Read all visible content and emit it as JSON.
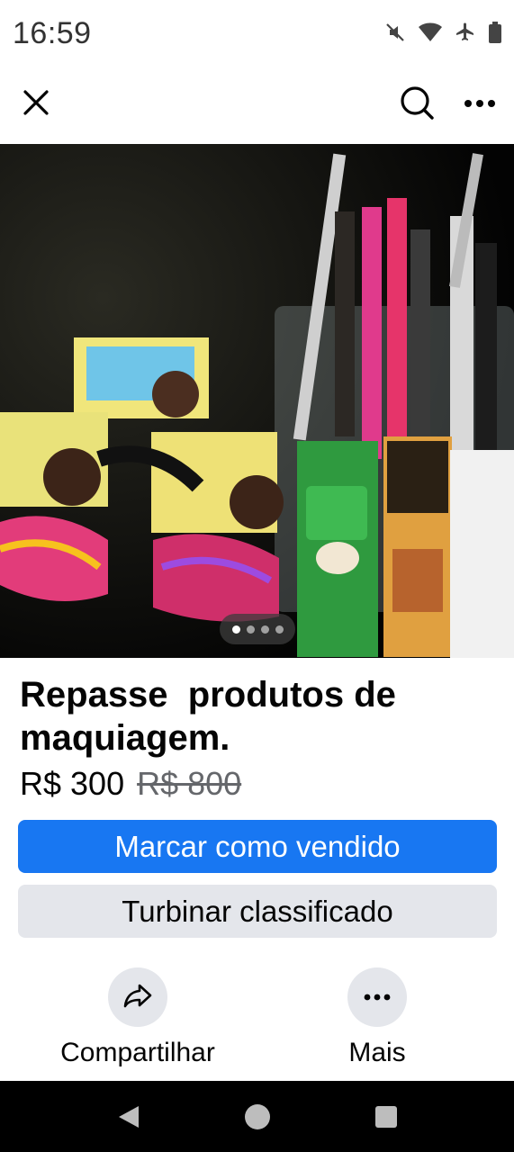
{
  "status_bar": {
    "time": "16:59",
    "icons": [
      "mute-icon",
      "wifi-icon",
      "airplane-icon",
      "battery-icon"
    ]
  },
  "top_bar": {
    "icons": [
      "close-icon",
      "search-icon",
      "more-icon"
    ]
  },
  "photo": {
    "pager": {
      "count": 4,
      "active_index": 0
    }
  },
  "listing": {
    "title": "Repasse  produtos de maquiagem.",
    "price": "R$ 300",
    "old_price": "R$ 800"
  },
  "buttons": {
    "mark_sold": "Marcar como vendido",
    "boost": "Turbinar classificado"
  },
  "actions": {
    "share_label": "Compartilhar",
    "more_label": "Mais"
  },
  "colors": {
    "primary": "#1877f2",
    "secondary_bg": "#e4e6eb",
    "text": "#050505",
    "muted": "#65676b"
  }
}
